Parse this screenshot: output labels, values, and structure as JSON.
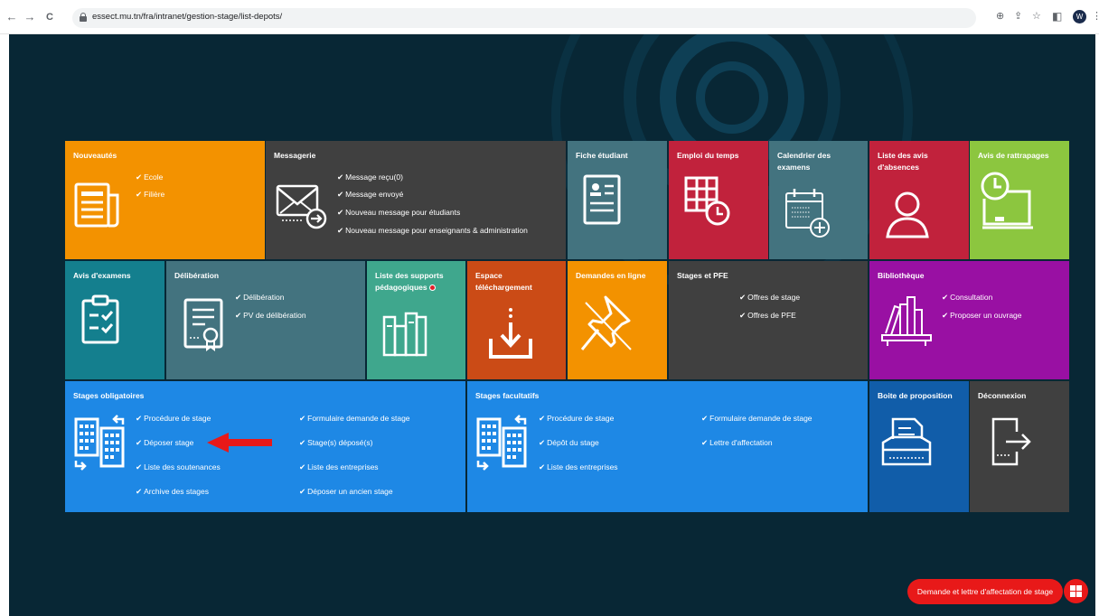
{
  "browser": {
    "url": "essect.mu.tn/fra/intranet/gestion-stage/list-depots/",
    "back_glyph": "←",
    "forward_glyph": "→",
    "reload_glyph": "C",
    "avatar_letter": "W"
  },
  "tiles": {
    "nouveautes": {
      "title": "Nouveautés",
      "links": [
        "Ecole",
        "Filière"
      ]
    },
    "messagerie": {
      "title": "Messagerie",
      "links": [
        "Message reçu(0)",
        "Message envoyé",
        "Nouveau message pour étudiants",
        "Nouveau message pour enseignants & administration"
      ]
    },
    "fiche": {
      "title": "Fiche étudiant"
    },
    "emploi": {
      "title": "Emploi du temps"
    },
    "calendrier": {
      "title": "Calendrier des",
      "title2": "examens"
    },
    "absences": {
      "title": "Liste des avis",
      "title2": "d'absences"
    },
    "rattrapages": {
      "title": "Avis de rattrapages"
    },
    "avis_examens": {
      "title": "Avis d'examens"
    },
    "deliberation": {
      "title": "Délibération",
      "links": [
        "Délibération",
        "PV de délibération"
      ]
    },
    "supports": {
      "title": "Liste des supports",
      "title2": "pédagogiques"
    },
    "telechargement": {
      "title": "Espace",
      "title2": "téléchargement"
    },
    "demandes": {
      "title": "Demandes en ligne"
    },
    "stages_pfe": {
      "title": "Stages et PFE",
      "links": [
        "Offres de stage",
        "Offres de PFE"
      ]
    },
    "bibliotheque": {
      "title": "Bibliothèque",
      "links": [
        "Consultation",
        "Proposer un ouvrage"
      ]
    },
    "obligatoires": {
      "title": "Stages obligatoires",
      "col1": [
        "Procédure de stage",
        "Déposer stage",
        "Liste des soutenances",
        "Archive des stages"
      ],
      "col2": [
        "Formulaire demande de stage",
        "Stage(s) déposé(s)",
        "Liste des entreprises",
        "Déposer un ancien stage"
      ]
    },
    "facultatifs": {
      "title": "Stages facultatifs",
      "col1": [
        "Procédure de stage",
        "Dépôt du stage",
        "Liste des entreprises"
      ],
      "col2": [
        "Formulaire demande de stage",
        "Lettre d'affectation"
      ]
    },
    "boite": {
      "title": "Boite de proposition"
    },
    "deconnexion": {
      "title": "Déconnexion"
    }
  },
  "cta": {
    "label": "Demande et lettre d'affectation de stage"
  },
  "colors": {
    "page_bg": "#082735",
    "orange": "#f39200",
    "dark": "#404040",
    "teal": "#43737f",
    "crimson": "#c1223c",
    "lime": "#8cc63f",
    "tealdark": "#147f8e",
    "green": "#3fa78d",
    "rust": "#cb4b16",
    "purple": "#9910a3",
    "blue": "#1e88e5",
    "navy": "#115da9",
    "red": "#e81919"
  }
}
